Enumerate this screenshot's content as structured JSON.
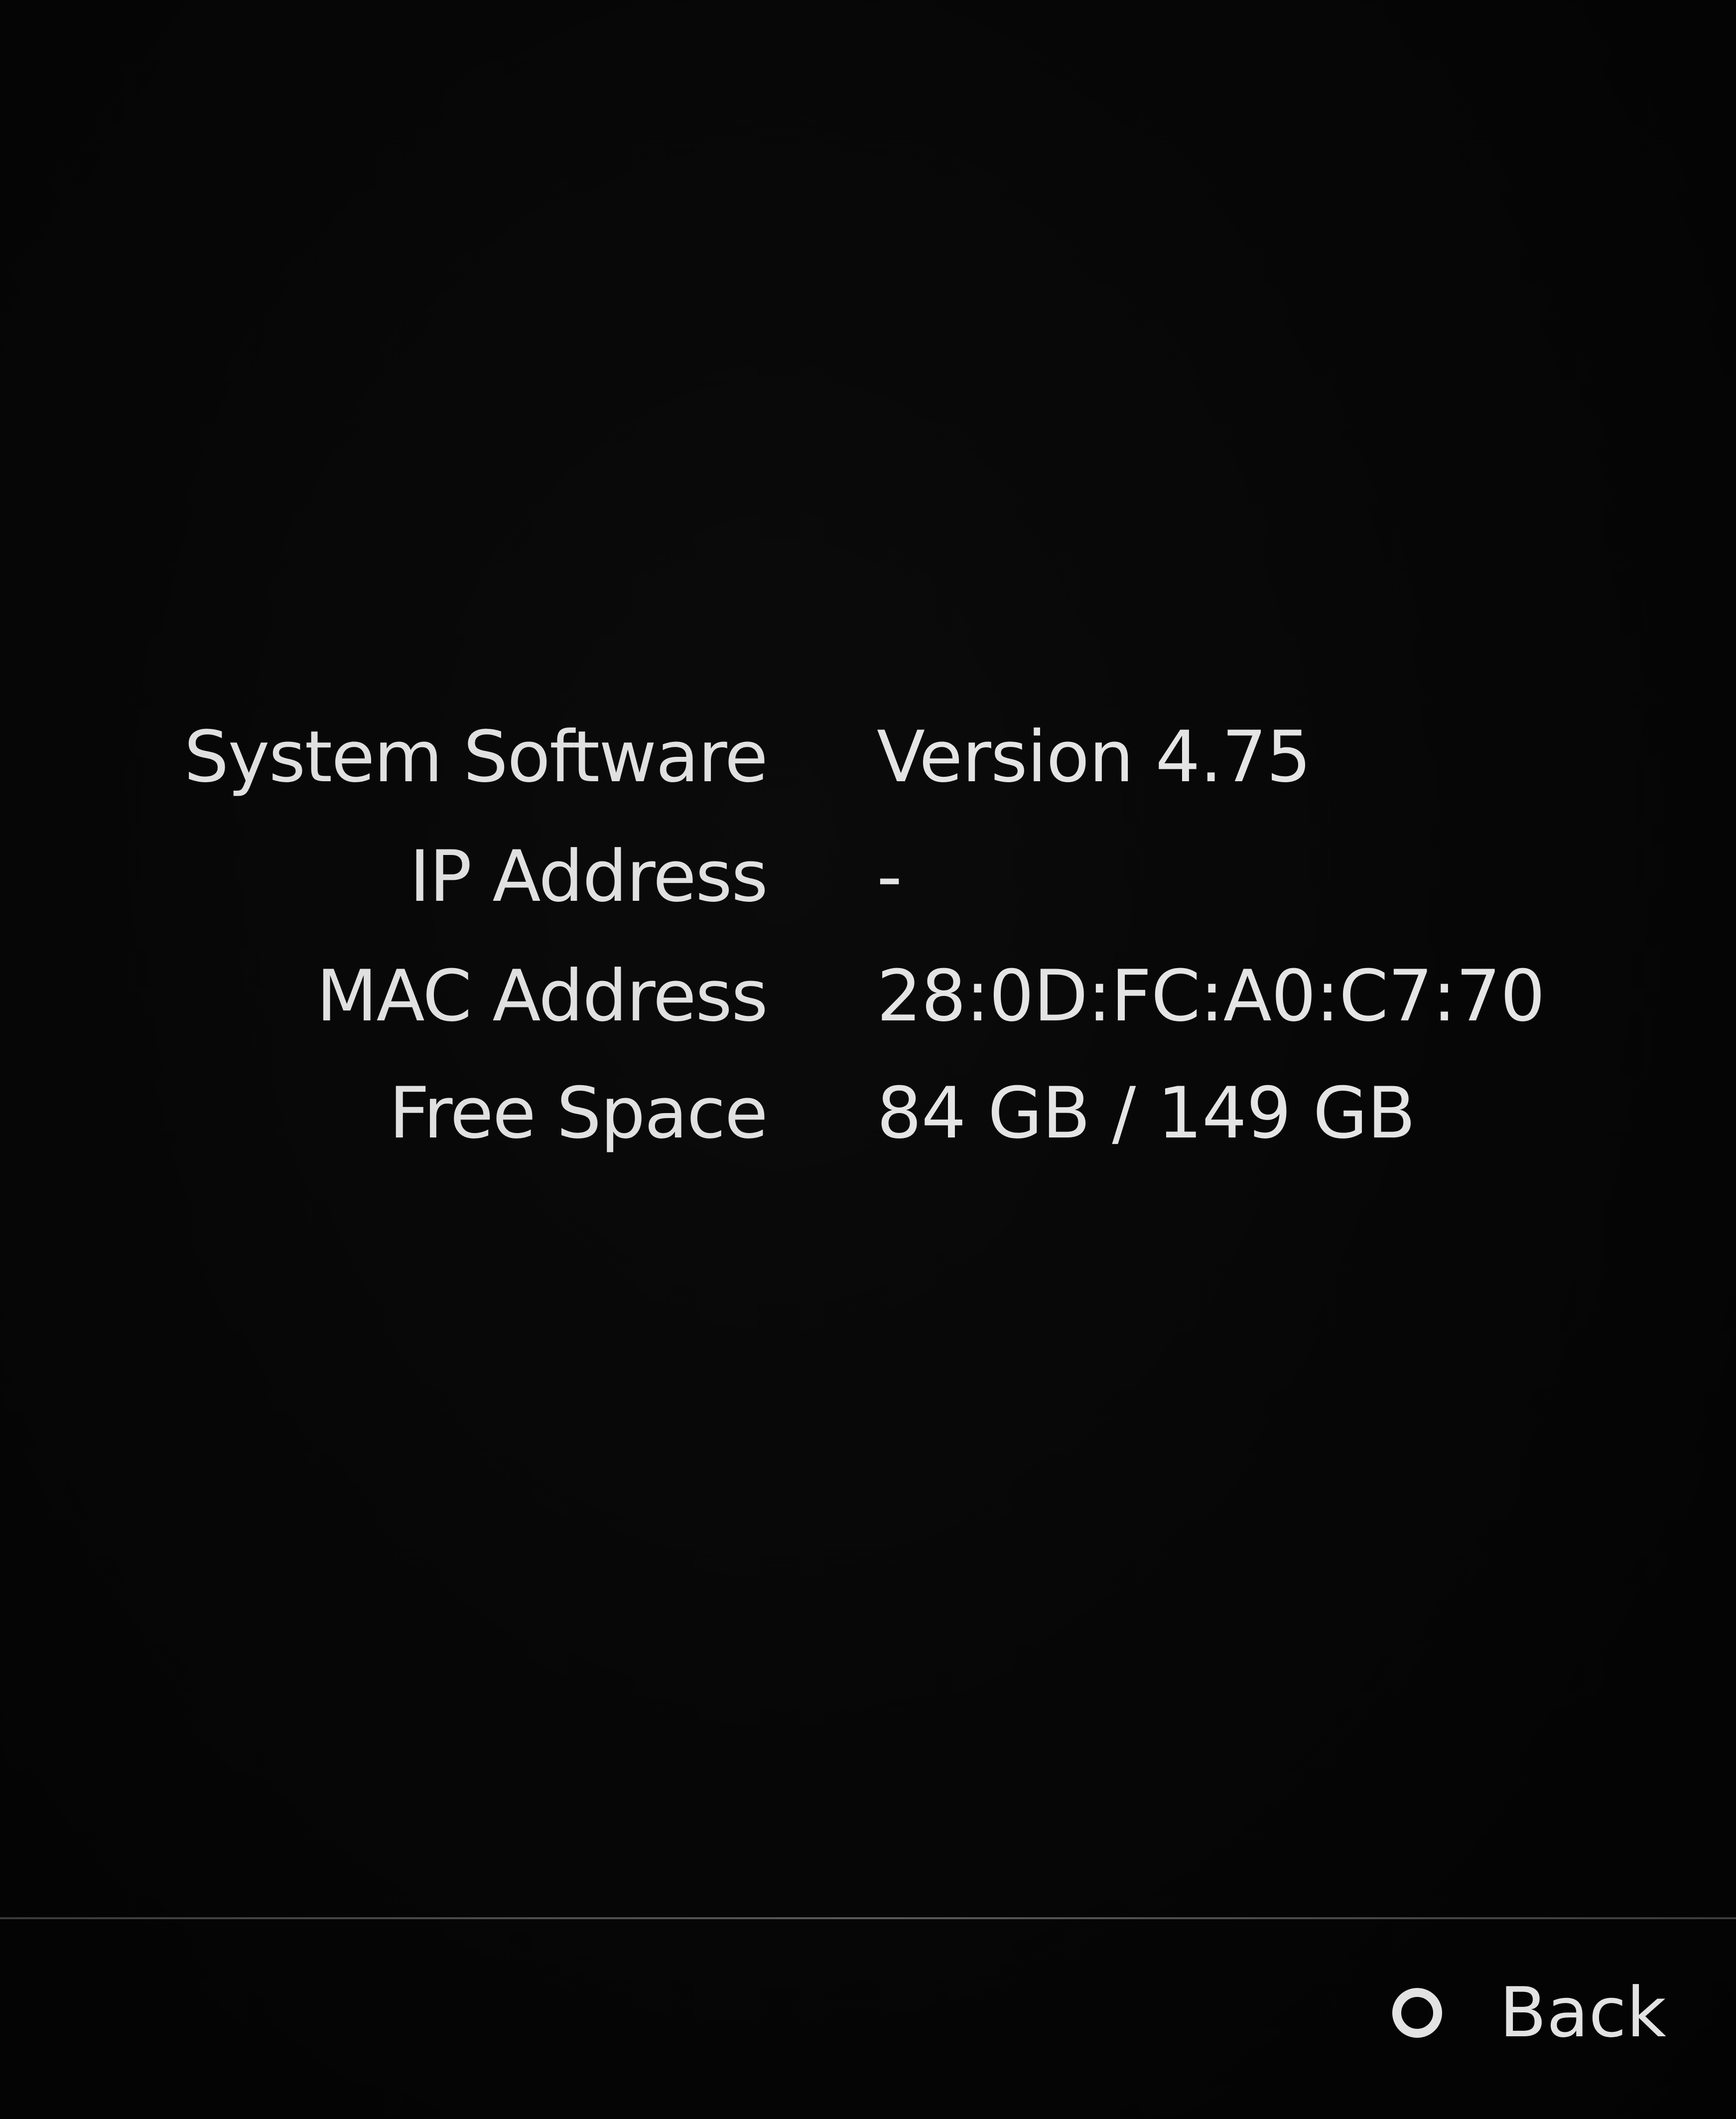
{
  "system_info": {
    "rows": [
      {
        "label": "System Software",
        "value": "Version 4.75"
      },
      {
        "label": "IP Address",
        "value": "-"
      },
      {
        "label": "MAC Address",
        "value": "28:0D:FC:A0:C7:70"
      },
      {
        "label": "Free Space",
        "value": "84 GB / 149 GB"
      }
    ]
  },
  "footer": {
    "back_label": "Back",
    "back_icon": "circle-button-icon"
  }
}
